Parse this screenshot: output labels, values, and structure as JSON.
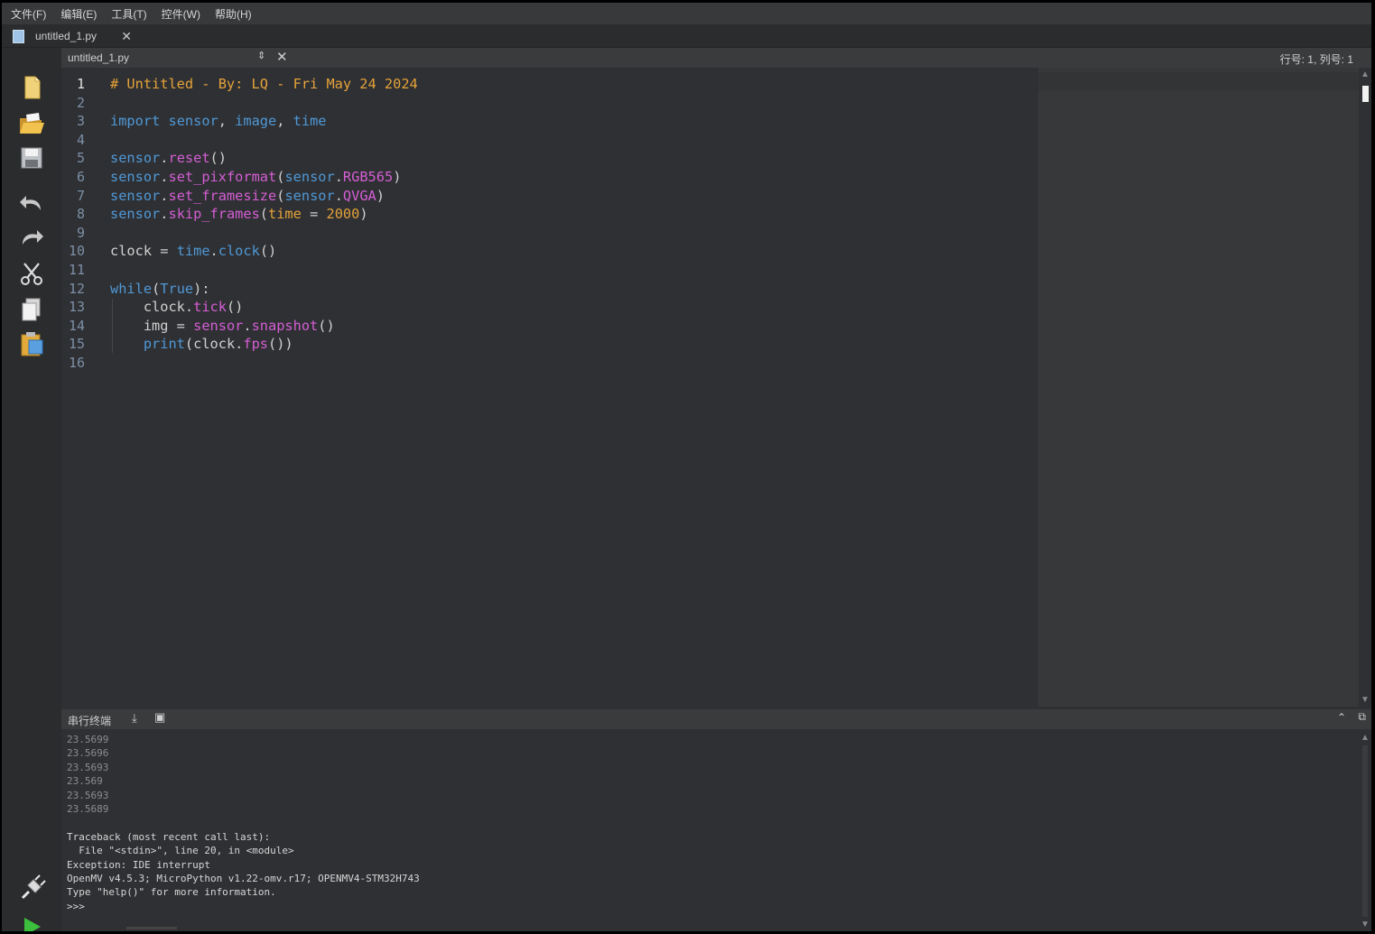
{
  "menu": [
    "文件(F)",
    "编辑(E)",
    "工具(T)",
    "控件(W)",
    "帮助(H)"
  ],
  "file_tab": {
    "label": "untitled_1.py",
    "close": "✕"
  },
  "editor": {
    "filename": "untitled_1.py",
    "updown": "⇕",
    "close": "✕",
    "cursor_position": "行号: 1, 列号: 1",
    "line_numbers": [
      "1",
      "2",
      "3",
      "4",
      "5",
      "6",
      "7",
      "8",
      "9",
      "10",
      "11",
      "12",
      "13",
      "14",
      "15",
      "16"
    ],
    "code": [
      [
        [
          "c-cmt",
          "# Untitled - By: LQ - Fri May 24 2024"
        ]
      ],
      [],
      [
        [
          "c-kw",
          "import"
        ],
        [
          "c-plain",
          " "
        ],
        [
          "c-kw",
          "sensor"
        ],
        [
          "c-plain",
          ", "
        ],
        [
          "c-kw",
          "image"
        ],
        [
          "c-plain",
          ", "
        ],
        [
          "c-kw",
          "time"
        ]
      ],
      [],
      [
        [
          "c-kw",
          "sensor"
        ],
        [
          "c-plain",
          "."
        ],
        [
          "c-fn",
          "reset"
        ],
        [
          "c-plain",
          "()"
        ]
      ],
      [
        [
          "c-kw",
          "sensor"
        ],
        [
          "c-plain",
          "."
        ],
        [
          "c-fn",
          "set_pixformat"
        ],
        [
          "c-plain",
          "("
        ],
        [
          "c-kw",
          "sensor"
        ],
        [
          "c-plain",
          "."
        ],
        [
          "c-fn",
          "RGB565"
        ],
        [
          "c-plain",
          ")"
        ]
      ],
      [
        [
          "c-kw",
          "sensor"
        ],
        [
          "c-plain",
          "."
        ],
        [
          "c-fn",
          "set_framesize"
        ],
        [
          "c-plain",
          "("
        ],
        [
          "c-kw",
          "sensor"
        ],
        [
          "c-plain",
          "."
        ],
        [
          "c-fn",
          "QVGA"
        ],
        [
          "c-plain",
          ")"
        ]
      ],
      [
        [
          "c-kw",
          "sensor"
        ],
        [
          "c-plain",
          "."
        ],
        [
          "c-fn",
          "skip_frames"
        ],
        [
          "c-plain",
          "("
        ],
        [
          "c-cmt",
          "time"
        ],
        [
          "c-plain",
          " = "
        ],
        [
          "c-num",
          "2000"
        ],
        [
          "c-plain",
          ")"
        ]
      ],
      [],
      [
        [
          "c-plain",
          "clock = "
        ],
        [
          "c-kw",
          "time"
        ],
        [
          "c-plain",
          "."
        ],
        [
          "c-kw",
          "clock"
        ],
        [
          "c-plain",
          "()"
        ]
      ],
      [],
      [
        [
          "c-kw",
          "while"
        ],
        [
          "c-plain",
          "("
        ],
        [
          "c-kw",
          "True"
        ],
        [
          "c-plain",
          "):"
        ]
      ],
      [
        [
          "c-plain",
          "    clock."
        ],
        [
          "c-fn",
          "tick"
        ],
        [
          "c-plain",
          "()"
        ]
      ],
      [
        [
          "c-plain",
          "    img = "
        ],
        [
          "c-fn",
          "sensor"
        ],
        [
          "c-plain",
          "."
        ],
        [
          "c-fn",
          "snapshot"
        ],
        [
          "c-plain",
          "()"
        ]
      ],
      [
        [
          "c-plain",
          "    "
        ],
        [
          "c-kw",
          "print"
        ],
        [
          "c-plain",
          "(clock."
        ],
        [
          "c-fn",
          "fps"
        ],
        [
          "c-plain",
          "())"
        ]
      ],
      []
    ]
  },
  "terminal": {
    "title": "串行终端",
    "fps_lines": [
      "23.5699",
      "23.5696",
      "23.5693",
      "23.569",
      "23.5693",
      "23.5689"
    ],
    "messages": [
      "Traceback (most recent call last):",
      "  File \"<stdin>\", line 20, in <module>",
      "Exception: IDE interrupt",
      "OpenMV v4.5.3; MicroPython v1.22-omv.r17; OPENMV4-STM32H743",
      "Type \"help()\" for more information.",
      ">>>"
    ]
  },
  "colors": {
    "background": "#2f3033",
    "comment": "#e5a33a",
    "keyword": "#4f98d6",
    "function": "#d45ed4",
    "line_number": "#7c8fa6"
  },
  "toolbar_icons": [
    "new-file-icon",
    "open-folder-icon",
    "save-icon",
    "undo-icon",
    "redo-icon",
    "cut-icon",
    "copy-icon",
    "paste-icon",
    "connect-plug-icon",
    "run-icon"
  ]
}
